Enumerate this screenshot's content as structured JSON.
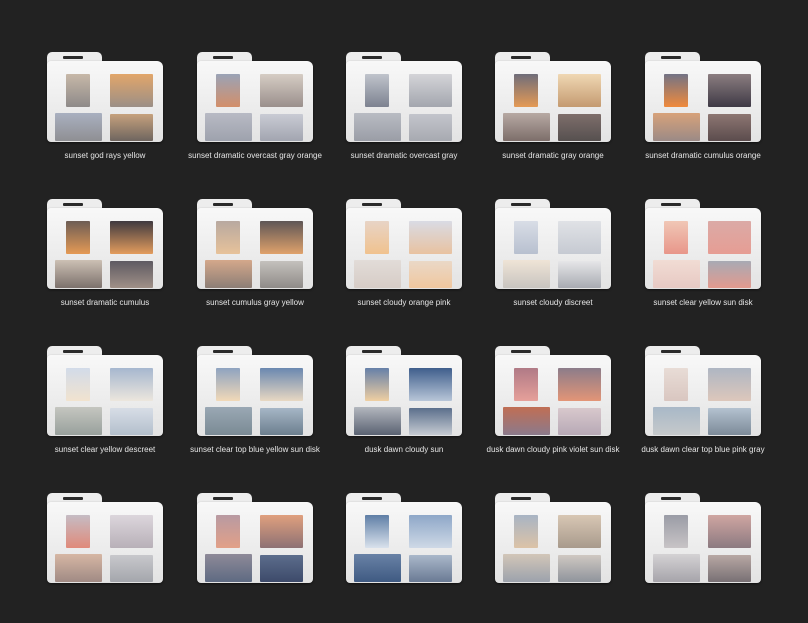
{
  "folders": [
    {
      "label": "sunset god rays yellow",
      "thumbs": [
        [
          "#c7b8a8",
          "#8e8a89"
        ],
        [
          "#e2a66a",
          "#9b8f86"
        ],
        [
          "#a9b0c0",
          "#8f8f93"
        ],
        [
          "#c6a17d",
          "#6e655f"
        ]
      ]
    },
    {
      "label": "sunset dramatic overcast gray orange",
      "thumbs": [
        [
          "#9aa3b6",
          "#d38f6a"
        ],
        [
          "#d6cdc4",
          "#9a8f8c"
        ],
        [
          "#b8bac4",
          "#9ea2ad"
        ],
        [
          "#c9cbd4",
          "#a2a5b0"
        ]
      ]
    },
    {
      "label": "sunset dramatic overcast gray",
      "thumbs": [
        [
          "#c0c4cc",
          "#7d8290"
        ],
        [
          "#d4d4d8",
          "#a3a6ae"
        ],
        [
          "#b9bcc3",
          "#9a9da6"
        ],
        [
          "#c3c5cc",
          "#a7aab1"
        ]
      ]
    },
    {
      "label": "sunset dramatic gray orange",
      "thumbs": [
        [
          "#6f6d7a",
          "#e59a55"
        ],
        [
          "#f0d8b4",
          "#c49a70"
        ],
        [
          "#b7a9a3",
          "#7d6e6a"
        ],
        [
          "#7e6e6b",
          "#56504f"
        ]
      ]
    },
    {
      "label": "sunset dramatic cumulus orange",
      "thumbs": [
        [
          "#737385",
          "#f08a3c"
        ],
        [
          "#8b7d80",
          "#3f3a46"
        ],
        [
          "#d7a27a",
          "#9b8a86"
        ],
        [
          "#8d7672",
          "#5b4c4d"
        ]
      ]
    },
    {
      "label": "sunset dramatic cumulus",
      "thumbs": [
        [
          "#6d5d55",
          "#e59a55"
        ],
        [
          "#3f3a40",
          "#e39d5d"
        ],
        [
          "#ccc0b4",
          "#7c716c"
        ],
        [
          "#5e5a62",
          "#a09087"
        ]
      ]
    },
    {
      "label": "sunset cumulus gray yellow",
      "thumbs": [
        [
          "#b8a9a0",
          "#e7c29a"
        ],
        [
          "#5e5656",
          "#e0a26b"
        ],
        [
          "#d4a88b",
          "#8c7e76"
        ],
        [
          "#c4c1bd",
          "#8f8b88"
        ]
      ]
    },
    {
      "label": "sunset cloudy orange pink",
      "thumbs": [
        [
          "#e8d4c6",
          "#f0c28e"
        ],
        [
          "#d9dbe4",
          "#e8c2a0"
        ],
        [
          "#e2dcd8",
          "#d6ccc6"
        ],
        [
          "#ead8c7",
          "#f0c79e"
        ]
      ]
    },
    {
      "label": "sunset cloudy discreet",
      "thumbs": [
        [
          "#d9dde6",
          "#b8c0cf"
        ],
        [
          "#e0e2e6",
          "#c6cad2"
        ],
        [
          "#efe4d6",
          "#c8c4c0"
        ],
        [
          "#e6e6e8",
          "#a8abb2"
        ]
      ]
    },
    {
      "label": "sunset clear yellow sun disk",
      "thumbs": [
        [
          "#f0c7b6",
          "#e8968a"
        ],
        [
          "#dbaaa6",
          "#e69d94"
        ],
        [
          "#f1dcd4",
          "#e7c9c3"
        ],
        [
          "#a8aab4",
          "#e39a8e"
        ]
      ]
    },
    {
      "label": "sunset clear yellow descreet",
      "thumbs": [
        [
          "#d2dbe9",
          "#f1e3cf"
        ],
        [
          "#a6b7cf",
          "#ece6dd"
        ],
        [
          "#c5c6c0",
          "#98a09c"
        ],
        [
          "#d7dde6",
          "#b3bfcc"
        ]
      ]
    },
    {
      "label": "sunset clear top blue yellow sun disk",
      "thumbs": [
        [
          "#8fa3c0",
          "#f2d9b8"
        ],
        [
          "#6a88b0",
          "#e8d8c2"
        ],
        [
          "#9aa8b4",
          "#7a8a94"
        ],
        [
          "#a6b6c6",
          "#6c7f8e"
        ]
      ]
    },
    {
      "label": "dusk dawn cloudy sun",
      "thumbs": [
        [
          "#6680a8",
          "#efcfa2"
        ],
        [
          "#3f5e8c",
          "#b8c6d8"
        ],
        [
          "#b3b7be",
          "#5a6272"
        ],
        [
          "#5b6f8c",
          "#c6cbd2"
        ]
      ]
    },
    {
      "label": "dusk dawn cloudy pink violet sun disk",
      "thumbs": [
        [
          "#b07a86",
          "#e6a09a"
        ],
        [
          "#8c7c8a",
          "#e39577"
        ],
        [
          "#c06e54",
          "#8b7a8c"
        ],
        [
          "#d8c8cc",
          "#b7a9b6"
        ]
      ]
    },
    {
      "label": "dusk dawn clear top blue pink gray",
      "thumbs": [
        [
          "#e8dcd6",
          "#d9c6c0"
        ],
        [
          "#aeb6c3",
          "#ddc7bb"
        ],
        [
          "#a8b8c7",
          "#c6c9cb"
        ],
        [
          "#b4c2d0",
          "#7c8a98"
        ]
      ]
    },
    {
      "label": "",
      "thumbs": [
        [
          "#c5bcc4",
          "#e08a7a"
        ],
        [
          "#dcd6dc",
          "#b8b0b8"
        ],
        [
          "#d6b7a4",
          "#a08a84"
        ],
        [
          "#c8c8cc",
          "#a4a6ac"
        ]
      ]
    },
    {
      "label": "",
      "thumbs": [
        [
          "#b89aa2",
          "#e2a088"
        ],
        [
          "#e0a07e",
          "#8d7174"
        ],
        [
          "#8e8a98",
          "#5e6a82"
        ],
        [
          "#5c6d8c",
          "#3d4a6a"
        ]
      ]
    },
    {
      "label": "",
      "thumbs": [
        [
          "#5f7fa6",
          "#d9e2ec"
        ],
        [
          "#8ea7c8",
          "#cfd9e6"
        ],
        [
          "#6982a6",
          "#3f5a82"
        ],
        [
          "#aab8ca",
          "#6a7a94"
        ]
      ]
    },
    {
      "label": "",
      "thumbs": [
        [
          "#a8b4c4",
          "#dcc3a7"
        ],
        [
          "#d8c7b4",
          "#a89a8c"
        ],
        [
          "#d2c6b8",
          "#9ca2ac"
        ],
        [
          "#cfc8c2",
          "#8f949c"
        ]
      ]
    },
    {
      "label": "",
      "thumbs": [
        [
          "#9a9ca6",
          "#c8c4c6"
        ],
        [
          "#cfa6a2",
          "#8c7a80"
        ],
        [
          "#d4d2d4",
          "#a6a4aa"
        ],
        [
          "#b8a8a4",
          "#787074"
        ]
      ]
    }
  ]
}
